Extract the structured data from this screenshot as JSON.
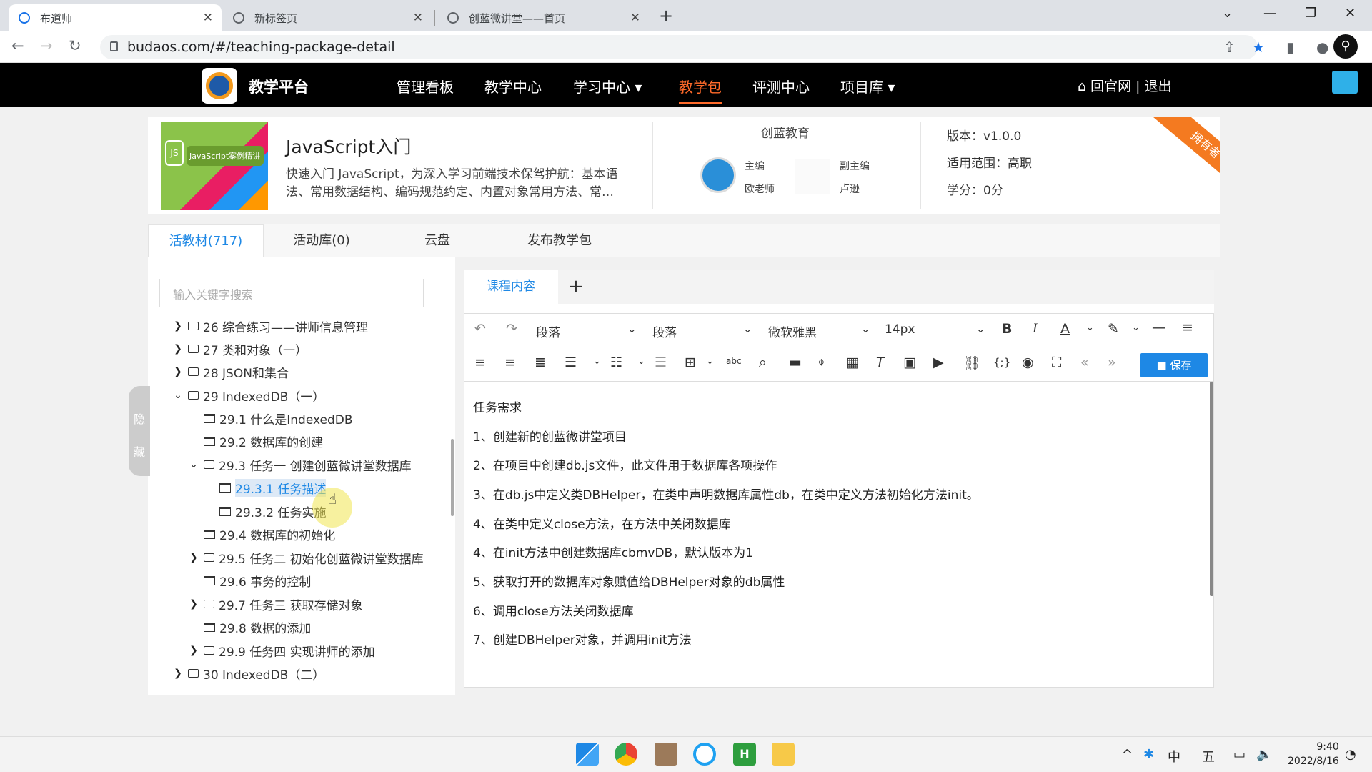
{
  "browser": {
    "tabs": [
      {
        "title": "布道师",
        "close": "✕"
      },
      {
        "title": "新标签页",
        "close": "✕"
      },
      {
        "title": "创蓝微讲堂——首页",
        "close": "✕"
      }
    ],
    "new_tab": "+",
    "url": "budaos.com/#/teaching-package-detail"
  },
  "app": {
    "brand": "教学平台",
    "nav": [
      "管理看板",
      "教学中心",
      "学习中心 ▾",
      "教学包",
      "评测中心",
      "项目库 ▾"
    ],
    "active_nav": "教学包",
    "right_links": "回官网 | 退出"
  },
  "package": {
    "cover_text": "JavaScript案例精讲",
    "cover_icon_text": "JS",
    "title": "JavaScript入门",
    "description": "快速入门 JavaScript，为深入学习前端技术保驾护航：基本语法、常用数据结构、编码规范约定、内置对象常用方法、常…",
    "org": "创蓝教育",
    "chief_editor_role": "主编",
    "chief_editor_name": "欧老师",
    "deputy_editor_role": "副主编",
    "deputy_editor_name": "卢逊",
    "version": "版本：v1.0.0",
    "scope": "适用范围：高职",
    "credit": "学分：0分",
    "ribbon": "拥有者"
  },
  "main_tabs": [
    "活教材(717)",
    "活动库(0)",
    "云盘",
    "发布教学包"
  ],
  "sidebar": {
    "search_placeholder": "输入关键字搜索",
    "hide_label": "隐藏",
    "tree": [
      {
        "label": "26 综合练习——讲师信息管理",
        "type": "folder",
        "expanded": false
      },
      {
        "label": "27 类和对象（一）",
        "type": "folder",
        "expanded": false
      },
      {
        "label": "28 JSON和集合",
        "type": "folder",
        "expanded": false
      },
      {
        "label": "29 IndexedDB（一）",
        "type": "folder",
        "expanded": true
      },
      {
        "label": "29.1 什么是IndexedDB",
        "type": "doc"
      },
      {
        "label": "29.2 数据库的创建",
        "type": "doc"
      },
      {
        "label": "29.3 任务一 创建创蓝微讲堂数据库",
        "type": "folder",
        "expanded": true
      },
      {
        "label": "29.3.1 任务描述",
        "type": "doc",
        "selected": true
      },
      {
        "label": "29.3.2 任务实施",
        "type": "doc"
      },
      {
        "label": "29.4 数据库的初始化",
        "type": "doc"
      },
      {
        "label": "29.5 任务二 初始化创蓝微讲堂数据库",
        "type": "folder",
        "expanded": false
      },
      {
        "label": "29.6 事务的控制",
        "type": "doc"
      },
      {
        "label": "29.7 任务三 获取存储对象",
        "type": "folder",
        "expanded": false
      },
      {
        "label": "29.8 数据的添加",
        "type": "doc"
      },
      {
        "label": "29.9 任务四 实现讲师的添加",
        "type": "folder",
        "expanded": false
      },
      {
        "label": "30 IndexedDB（二）",
        "type": "folder",
        "expanded": false
      }
    ]
  },
  "editor": {
    "tab": "课程内容",
    "add_tab": "+",
    "paragraph_select": "段落",
    "paragraph_select2": "段落",
    "font_select": "微软雅黑",
    "size_select": "14px",
    "save_label": "■ 保存",
    "lines": [
      "任务需求",
      "1、创建新的创蓝微讲堂项目",
      "2、在项目中创建db.js文件，此文件用于数据库各项操作",
      "3、在db.js中定义类DBHelper，在类中声明数据库属性db，在类中定义方法初始化方法init。",
      "4、在类中定义close方法，在方法中关闭数据库",
      "4、在init方法中创建数据库cbmvDB，默认版本为1",
      "5、获取打开的数据库对象赋值给DBHelper对象的db属性",
      "6、调用close方法关闭数据库",
      "7、创建DBHelper对象，并调用init方法"
    ]
  },
  "taskbar": {
    "ime": "中",
    "ime2": "五",
    "time": "9:40",
    "date": "2022/8/16"
  },
  "colors": {
    "accent": "#1e88e5",
    "nav_active": "#ff6a2a",
    "ribbon": "#f47a20"
  }
}
